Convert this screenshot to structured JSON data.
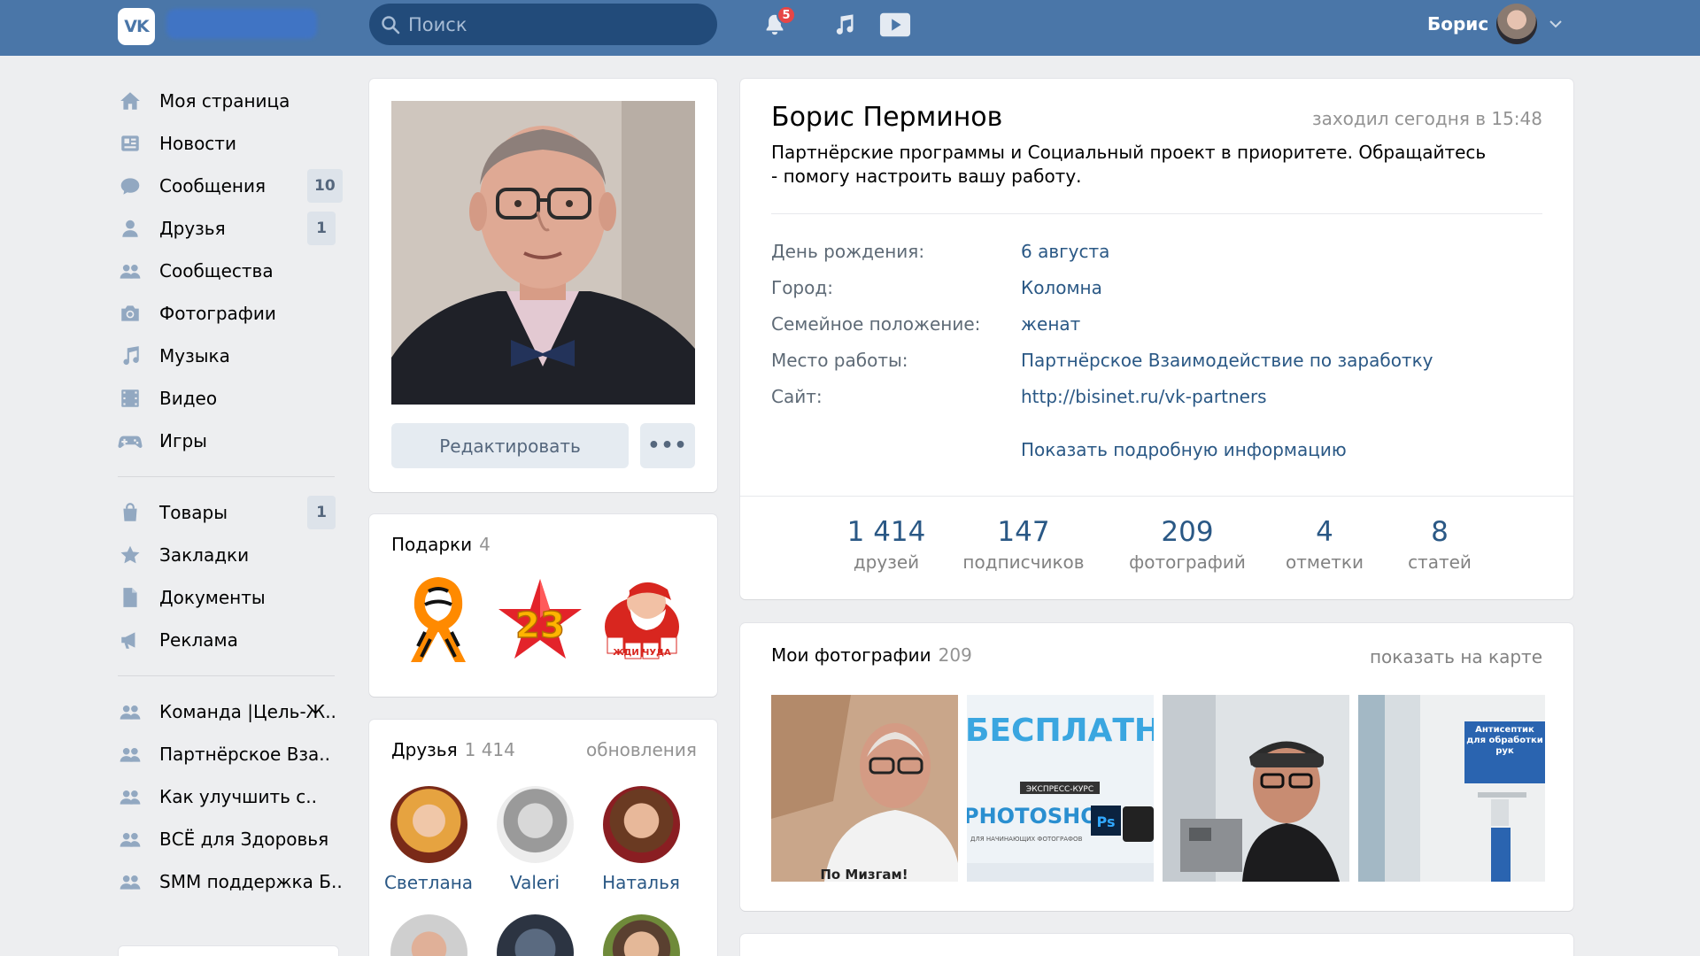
{
  "header": {
    "logo_text": "VK",
    "search_placeholder": "Поиск",
    "notifications_count": "5",
    "user_name": "Борис",
    "accent": "#4a76a8"
  },
  "nav": {
    "items": [
      {
        "label": "Моя страница",
        "icon": "home-icon"
      },
      {
        "label": "Новости",
        "icon": "news-icon"
      },
      {
        "label": "Сообщения",
        "icon": "messages-icon",
        "count": "10"
      },
      {
        "label": "Друзья",
        "icon": "friends-icon",
        "count": "1"
      },
      {
        "label": "Сообщества",
        "icon": "groups-icon"
      },
      {
        "label": "Фотографии",
        "icon": "camera-icon"
      },
      {
        "label": "Музыка",
        "icon": "music-icon"
      },
      {
        "label": "Видео",
        "icon": "video-icon"
      },
      {
        "label": "Игры",
        "icon": "games-icon"
      }
    ],
    "items2": [
      {
        "label": "Товары",
        "icon": "bag-icon",
        "count": "1"
      },
      {
        "label": "Закладки",
        "icon": "star-icon"
      },
      {
        "label": "Документы",
        "icon": "document-icon"
      },
      {
        "label": "Реклама",
        "icon": "megaphone-icon"
      }
    ],
    "groups": [
      {
        "label": "Команда |Цель-Ж.."
      },
      {
        "label": "Партнёрское Вза.."
      },
      {
        "label": "Как улучшить с.."
      },
      {
        "label": "ВСЁ для Здоровья"
      },
      {
        "label": "SMM поддержка Б.."
      }
    ]
  },
  "profile_photo": {
    "edit_label": "Редактировать",
    "more_label": "•••"
  },
  "gifts": {
    "title": "Подарки",
    "count": "4",
    "gift_23_text": "23",
    "gift_santa_text": "ЖДИ ЧУДА"
  },
  "friends": {
    "title": "Друзья",
    "count": "1 414",
    "updates": "обновления",
    "list": [
      {
        "name": "Светлана"
      },
      {
        "name": "Valeri"
      },
      {
        "name": "Наталья"
      }
    ]
  },
  "profile": {
    "name": "Борис Перминов",
    "online": "заходил сегодня в 15:48",
    "status": "Партнёрские программы и Социальный проект в приоритете. Обращайтесь - помогу настроить вашу работу.",
    "fields": [
      {
        "key": "День рождения:",
        "value": "6 августа"
      },
      {
        "key": "Город:",
        "value": "Коломна"
      },
      {
        "key": "Семейное положение:",
        "value": "женат"
      },
      {
        "key": "Место работы:",
        "value": "Партнёрское Взаимодействие по заработку"
      },
      {
        "key": "Сайт:",
        "value": "http://bisinet.ru/vk-partners"
      }
    ],
    "show_more": "Показать подробную информацию",
    "counters": [
      {
        "num": "1 414",
        "label": "друзей"
      },
      {
        "num": "147",
        "label": "подписчиков"
      },
      {
        "num": "209",
        "label": "фотографий"
      },
      {
        "num": "4",
        "label": "отметки"
      },
      {
        "num": "8",
        "label": "статей"
      }
    ]
  },
  "photos": {
    "title": "Мои фотографии",
    "count": "209",
    "map_link": "показать на карте",
    "photo2_text1": "БЕСПЛАТНО",
    "photo2_text2": "ЭКСПРЕСС-КУРС",
    "photo2_text3": "PHOTOSHOP",
    "photo2_text4": "Ps",
    "photo2_text5": "ДЛЯ НАЧИНАЮЩИХ ФОТОГРАФОВ",
    "photo1_text": "По Мизгам!",
    "photo4_text": "Антисептик для обработки рук"
  }
}
